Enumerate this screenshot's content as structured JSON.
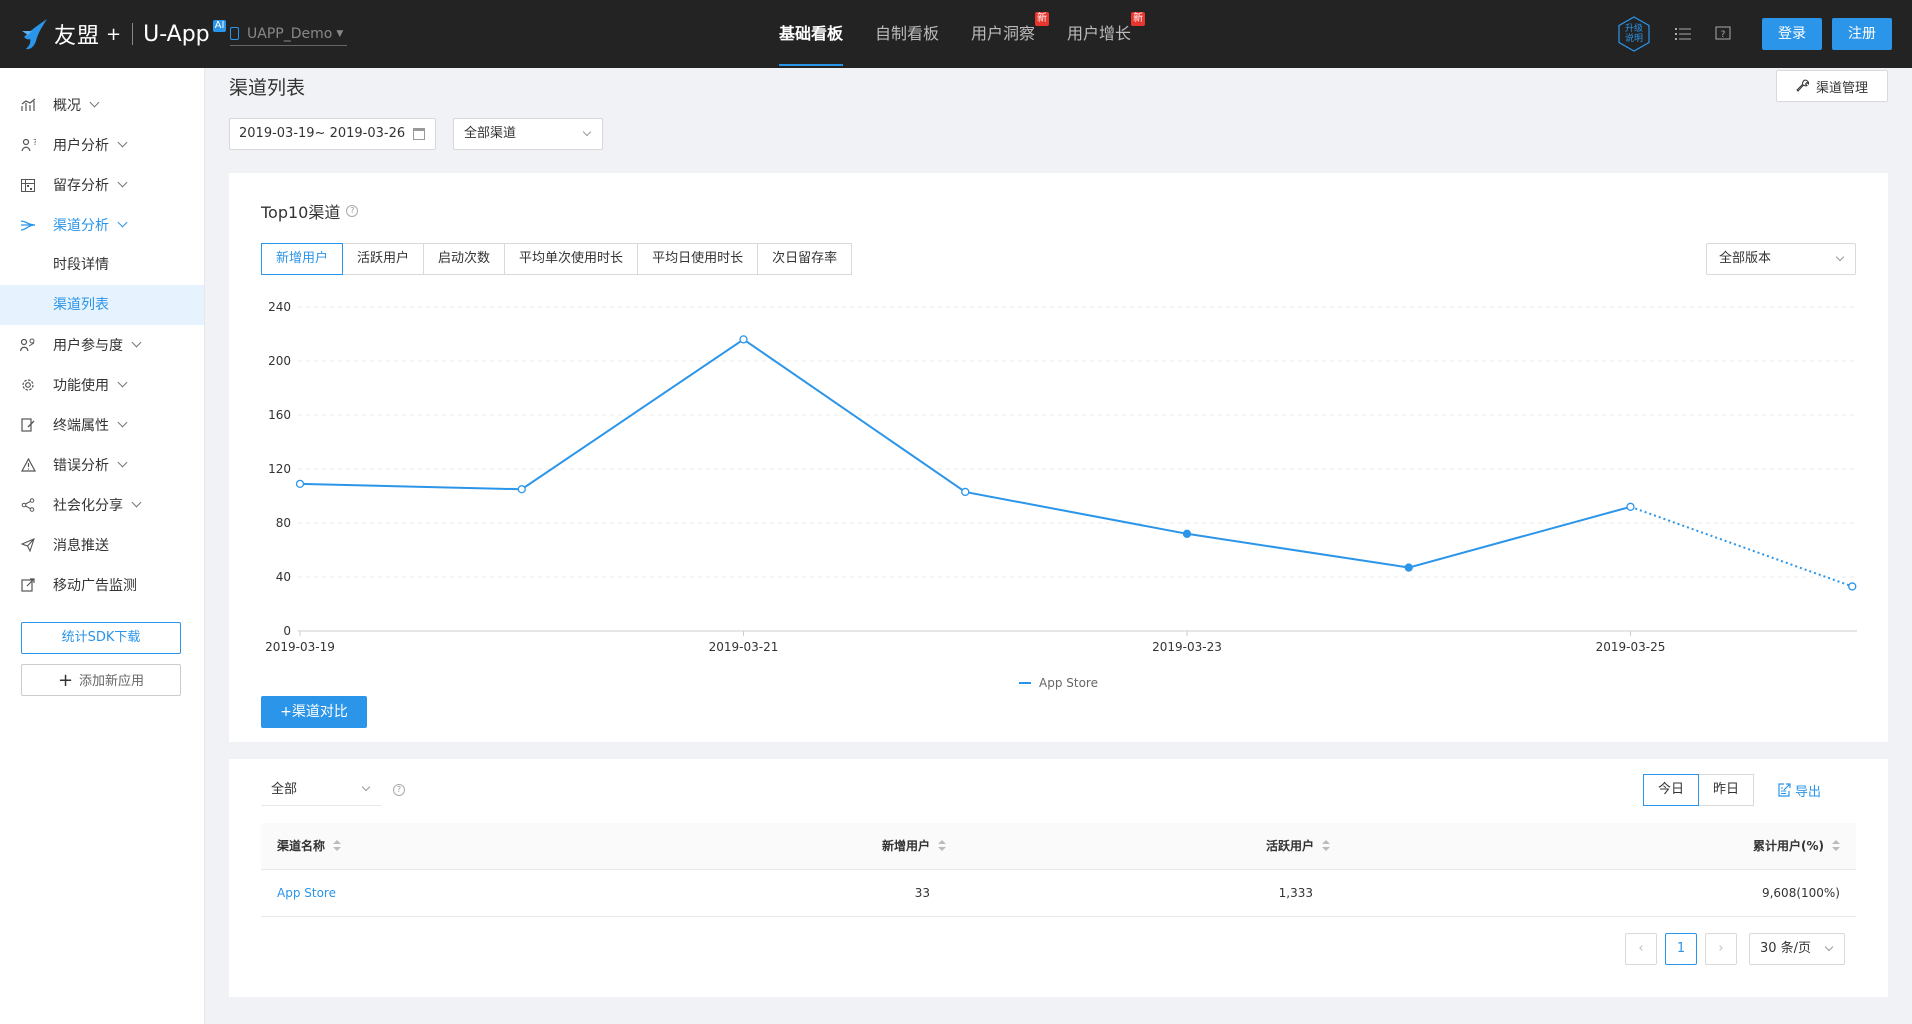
{
  "topbar": {
    "brand": "友盟",
    "brand_plus": "+",
    "product": "U-App",
    "ai_badge": "AI",
    "app_name": "UAPP_Demo",
    "nav": [
      {
        "label": "基础看板",
        "active": true,
        "badge": ""
      },
      {
        "label": "自制看板",
        "active": false,
        "badge": ""
      },
      {
        "label": "用户洞察",
        "active": false,
        "badge": "新"
      },
      {
        "label": "用户增长",
        "active": false,
        "badge": "新"
      }
    ],
    "upgrade_line1": "升级",
    "upgrade_line2": "说明",
    "login": "登录",
    "register": "注册"
  },
  "sidebar": {
    "items": [
      {
        "label": "概况",
        "icon": "chart-line-icon"
      },
      {
        "label": "用户分析",
        "icon": "user-question-icon"
      },
      {
        "label": "留存分析",
        "icon": "table-icon"
      },
      {
        "label": "渠道分析",
        "icon": "channel-icon"
      },
      {
        "label": "用户参与度",
        "icon": "user-engage-icon"
      },
      {
        "label": "功能使用",
        "icon": "gear-icon"
      },
      {
        "label": "终端属性",
        "icon": "device-edit-icon"
      },
      {
        "label": "错误分析",
        "icon": "warning-icon"
      },
      {
        "label": "社会化分享",
        "icon": "share-icon"
      },
      {
        "label": "消息推送",
        "icon": "send-icon"
      },
      {
        "label": "移动广告监测",
        "icon": "ad-monitor-icon"
      }
    ],
    "sub": [
      {
        "label": "时段详情",
        "active": false
      },
      {
        "label": "渠道列表",
        "active": true
      }
    ],
    "sdk_download": "统计SDK下载",
    "add_app": "添加新应用"
  },
  "main": {
    "title": "渠道列表",
    "manage": "渠道管理",
    "date_range": "2019-03-19~ 2019-03-26",
    "channel_filter": "全部渠道"
  },
  "top10": {
    "title": "Top10渠道",
    "tabs": [
      "新增用户",
      "活跃用户",
      "启动次数",
      "平均单次使用时长",
      "平均日使用时长",
      "次日留存率"
    ],
    "active_tab": 0,
    "version": "全部版本",
    "compare": "渠道对比"
  },
  "chart_data": {
    "type": "line",
    "x": [
      "2019-03-19",
      "2019-03-20",
      "2019-03-21",
      "2019-03-22",
      "2019-03-23",
      "2019-03-24",
      "2019-03-25",
      "2019-03-26"
    ],
    "x_tick_labels": [
      "2019-03-19",
      "2019-03-21",
      "2019-03-23",
      "2019-03-25"
    ],
    "series": [
      {
        "name": "App Store",
        "values": [
          109,
          105,
          216,
          103,
          72,
          47,
          92,
          33
        ],
        "color": "#2b95e9",
        "dotted_last_segment": true
      }
    ],
    "ylim": [
      0,
      240
    ],
    "yticks": [
      0,
      40,
      80,
      120,
      160,
      200,
      240
    ],
    "grid": true,
    "legend": "bottom-center"
  },
  "table_section": {
    "filter": "全部",
    "today": "今日",
    "yesterday": "昨日",
    "export": "导出",
    "columns": [
      "渠道名称",
      "新增用户",
      "活跃用户",
      "累计用户(%)"
    ],
    "rows": [
      {
        "name": "App Store",
        "new_users": "33",
        "active_users": "1,333",
        "total_users": "9,608(100%)"
      }
    ],
    "page": "1",
    "page_size": "30 条/页",
    "prev": "‹",
    "next": "›"
  }
}
